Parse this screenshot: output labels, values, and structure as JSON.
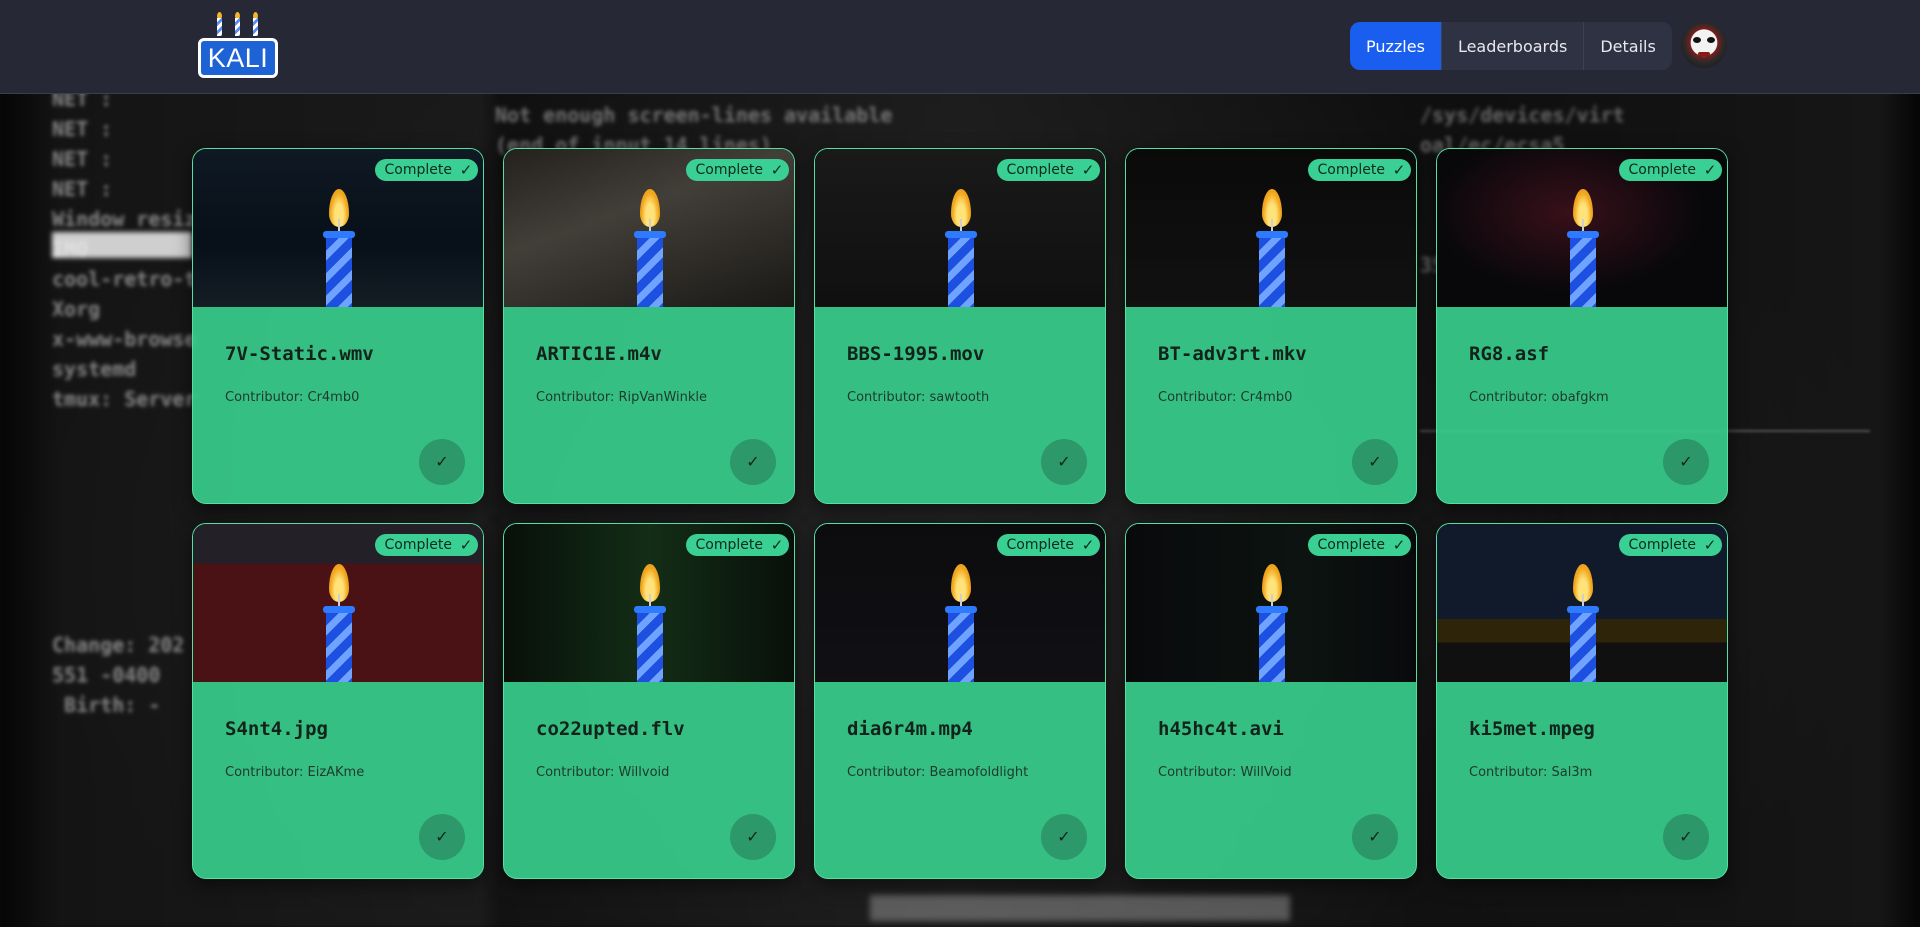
{
  "header": {
    "logo_text": "KALI",
    "nav": [
      {
        "label": "Puzzles",
        "active": true
      },
      {
        "label": "Leaderboards",
        "active": false
      },
      {
        "label": "Details",
        "active": false
      }
    ],
    "avatar_icon": "jigsaw-mask-icon"
  },
  "colors": {
    "header_bg": "#262836",
    "nav_active": "#1a5ef0",
    "card_bg": "#38cd8c",
    "badge_bg": "#3ad094"
  },
  "status_label": "Complete",
  "contributor_prefix": "Contributor: ",
  "cards": [
    {
      "title": "7V-Static.wmv",
      "contributor": "Contributor: Cr4mb0",
      "art": "hooded-figure"
    },
    {
      "title": "ARTIC1E.m4v",
      "contributor": "Contributor: RipVanWinkle",
      "art": "newspaper"
    },
    {
      "title": "BBS-1995.mov",
      "contributor": "Contributor: sawtooth",
      "art": "arg-soc-logo"
    },
    {
      "title": "BT-adv3rt.mkv",
      "contributor": "Contributor: Cr4mb0",
      "art": "security-poster"
    },
    {
      "title": "RG8.asf",
      "contributor": "Contributor: obafgkm",
      "art": "kali-dragon"
    },
    {
      "title": "S4nt4.jpg",
      "contributor": "Contributor: EizAKme",
      "art": "red-house"
    },
    {
      "title": "co22upted.flv",
      "contributor": "Contributor: Willvoid",
      "art": "green-matrix"
    },
    {
      "title": "dia6r4m.mp4",
      "contributor": "Contributor: Beamofoldlight",
      "art": "circuit-diagram"
    },
    {
      "title": "h45hc4t.avi",
      "contributor": "Contributor: WillVoid",
      "art": "dark-code"
    },
    {
      "title": "ki5met.mpeg",
      "contributor": "Contributor: Sal3m",
      "art": "desktop-screenshot"
    }
  ]
}
